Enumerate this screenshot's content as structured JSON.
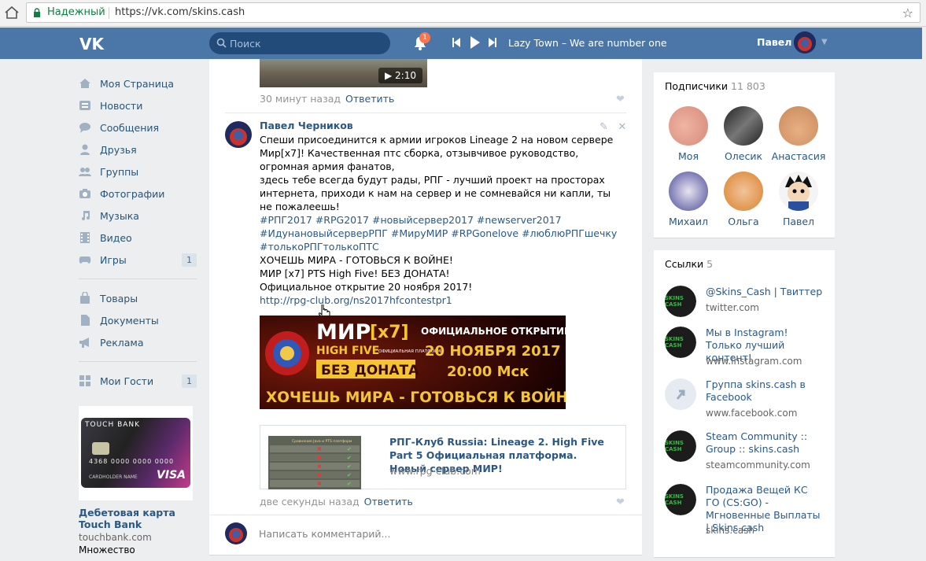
{
  "browser": {
    "secure_label": "Надежный",
    "url": "https://vk.com/skins.cash"
  },
  "header": {
    "search_placeholder": "Поиск",
    "notif_count": "1",
    "track": "Lazy Town – We are number one",
    "user_name": "Павел"
  },
  "sidebar": {
    "items": [
      {
        "label": "Моя Страница",
        "icon": "home-icon"
      },
      {
        "label": "Новости",
        "icon": "news-icon"
      },
      {
        "label": "Сообщения",
        "icon": "messages-icon"
      },
      {
        "label": "Друзья",
        "icon": "friends-icon"
      },
      {
        "label": "Группы",
        "icon": "groups-icon"
      },
      {
        "label": "Фотографии",
        "icon": "camera-icon"
      },
      {
        "label": "Музыка",
        "icon": "music-icon"
      },
      {
        "label": "Видео",
        "icon": "video-icon"
      },
      {
        "label": "Игры",
        "icon": "games-icon",
        "count": "1"
      }
    ],
    "items2": [
      {
        "label": "Товары",
        "icon": "bag-icon"
      },
      {
        "label": "Документы",
        "icon": "document-icon"
      },
      {
        "label": "Реклама",
        "icon": "megaphone-icon"
      }
    ],
    "guests": {
      "label": "Мои Гости",
      "count": "1"
    },
    "ad": {
      "card_brand": "TOUCH BANK",
      "card_number": "4368 0000 0000 0000",
      "card_holder": "CARDHOLDER NAME",
      "card_network": "VISA",
      "title": "Дебетовая карта Touch Bank",
      "domain": "touchbank.com",
      "extra": "Множество"
    }
  },
  "feed": {
    "prev_comment": {
      "duration": "2:10",
      "time": "30 минут назад",
      "reply": "Ответить"
    },
    "comment": {
      "author": "Павел Черников",
      "text1": "Спеши присоединится к армии игроков Lineage 2 на новом сервере Мир[x7]! Качественная птс сборка, отзывчивое руководство, огромная армия фанатов,",
      "text2": "здесь тебе всегда будут рады, РПГ - лучший проект на просторах интернета, приходи к нам на сервер и не сомневайся ни капли, ты не пожалеешь!",
      "tags": "#РПГ2017 #RPG2017 #новыйсервер2017 #newserver2017 #ИдунановыйсерверРПГ #МируМИР #RPGonelove #люблюРПГшечку #толькоРПГтолькоПТС",
      "line1": "ХОЧЕШЬ МИРА - ГОТОВЬСЯ К ВОЙНЕ!",
      "line2": "МИР [x7] PTS High Five! БЕЗ ДОНАТА!",
      "line3": "Официальное открытие 20 ноября 2017!",
      "link": "http://rpg-club.org/ns2017hfcontestpr1",
      "banner": {
        "title": "МИР",
        "x7": "[x7]",
        "hf": "HIGH FIVE",
        "platform": "ОФИЦИАЛЬНАЯ ПЛАТФОРМА",
        "opening": "ОФИЦИАЛЬНОЕ ОТКРЫТИЕ",
        "date": "20 НОЯБРЯ 2017",
        "time": "20:00 Мск",
        "nodonate": "БЕЗ ДОНАТА",
        "slogan": "ХОЧЕШЬ МИРА - ГОТОВЬСЯ К ВОЙНЕ"
      },
      "snippet": {
        "title": "РПГ-Клуб Russia: Lineage 2. High Five Part 5 Официальная платформа. Новый сервер МИР!",
        "url": "www.rpg-club.com",
        "thumb_heading": "Сравнение Java и PTS платформ"
      },
      "time": "две секунды назад",
      "reply": "Ответить"
    },
    "comment_placeholder": "Написать комментарий..."
  },
  "subscribers": {
    "title": "Подписчики",
    "count": "11 803",
    "people": [
      "Моя",
      "Олесик",
      "Анастасия",
      "Михаил",
      "Ольга",
      "Павел"
    ]
  },
  "links": {
    "title": "Ссылки",
    "count": "5",
    "items": [
      {
        "title": "@Skins_Cash | Твиттер",
        "url": "twitter.com"
      },
      {
        "title": "Мы в Instagram! Только лучший контент!",
        "url": "www.instagram.com"
      },
      {
        "title": "Группа skins.cash в Facebook",
        "url": "www.facebook.com"
      },
      {
        "title": "Steam Community :: Group :: skins.cash",
        "url": "steamcommunity.com"
      },
      {
        "title": "Продажа Вещей КС ГО (CS:GO) - Мгновенные Выплаты | Skins.cash",
        "url": "skins.cash"
      }
    ],
    "logo_text": "SKINS CASH"
  },
  "colors": {
    "vk_blue": "#4a76a8",
    "link": "#2a5885",
    "bg": "#edeef0"
  }
}
